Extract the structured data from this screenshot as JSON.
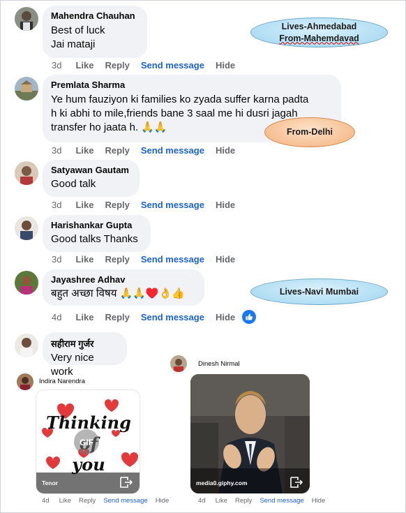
{
  "comments": [
    {
      "name": "Mahendra Chauhan",
      "lines": [
        "Best of luck",
        "Jai mataji"
      ],
      "time": "3d"
    },
    {
      "name": "Premlata Sharma",
      "lines": [
        "Ye hum fauziyon ki families ko zyada suffer karna padta",
        "h ki abhi to mile,friends bane 3 saal me hi dusri jagah",
        "transfer ho jaata h. 🙏🙏"
      ],
      "time": "3d"
    },
    {
      "name": "Satyawan Gautam",
      "lines": [
        "Good talk"
      ],
      "time": "3d"
    },
    {
      "name": "Harishankar Gupta",
      "lines": [
        "Good talks Thanks"
      ],
      "time": "3d"
    },
    {
      "name": "Jayashree Adhav",
      "lines": [
        "बहुत अच्छा विषय 🙏🙏♥️👌👍"
      ],
      "time": "4d"
    },
    {
      "name": "सहीराम गुर्जर",
      "lines": [
        "Very nice work"
      ],
      "time": ""
    }
  ],
  "actions": {
    "like": "Like",
    "reply": "Reply",
    "send": "Send message",
    "hide": "Hide"
  },
  "gif_comments": [
    {
      "name": "Indira Narendra",
      "time": "4d",
      "source": "Tenor",
      "gif_text": "Thinking of you"
    },
    {
      "name": "Dinesh Nirmal",
      "time": "4d",
      "source": "media0.giphy.com"
    }
  ],
  "annotations": [
    {
      "lines": [
        "Lives-Ahmedabad",
        "From-Mahemdavad"
      ],
      "style": "blue"
    },
    {
      "lines": [
        "From-Delhi"
      ],
      "style": "orange"
    },
    {
      "lines": [
        "Lives-Navi Mumbai"
      ],
      "style": "blue"
    }
  ],
  "colors": {
    "bubble": "#f0f2f5",
    "send_link": "#1b62d8",
    "meta_text": "#65676b",
    "like_badge": "#1877f2"
  }
}
